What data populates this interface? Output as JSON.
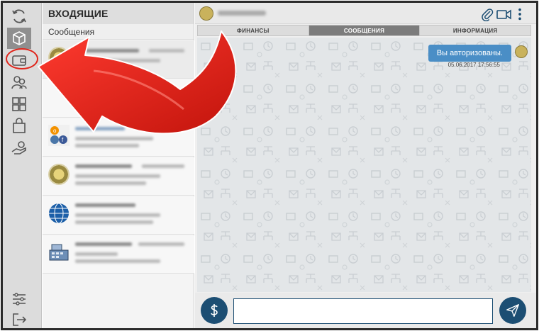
{
  "list": {
    "title": "ВХОДЯЩИЕ",
    "subtitle": "Сообщения"
  },
  "tabs": [
    {
      "label": "ФИНАНСЫ",
      "active": false
    },
    {
      "label": "СООБЩЕНИЯ",
      "active": true
    },
    {
      "label": "ИНФОРМАЦИЯ",
      "active": false
    }
  ],
  "chat": {
    "message_text": "Вы авторизованы.",
    "message_time": "05.06.2017 17:56:55",
    "input_value": "",
    "input_placeholder": ""
  },
  "rail_icons": [
    "refresh-icon",
    "box-icon",
    "wallet-icon",
    "contacts-icon",
    "apps-icon",
    "shopping-bag-icon",
    "hand-coin-icon",
    "settings-sliders-icon",
    "exit-icon"
  ],
  "colors": {
    "accent": "#1c4e73",
    "bubble": "#4a8ec6",
    "annotation": "#e0251b"
  }
}
